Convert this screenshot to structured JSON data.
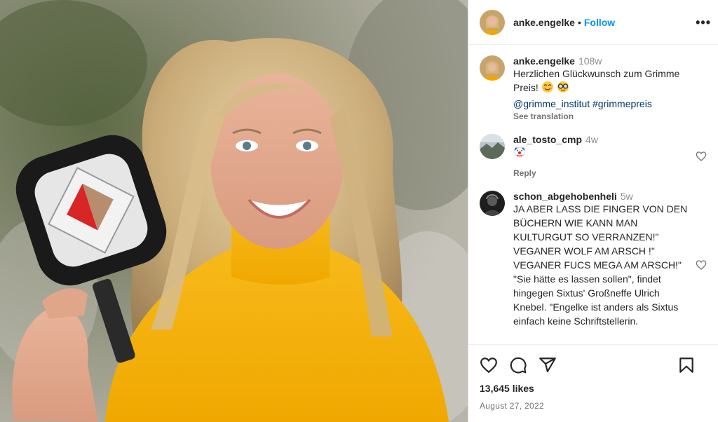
{
  "post": {
    "author": "anke.engelke",
    "follow_label": "Follow",
    "separator": "•",
    "more_label": "•••"
  },
  "caption": {
    "username": "anke.engelke",
    "time": "108w",
    "text": "Herzlichen Glückwunsch zum Grimme Preis!",
    "emojis": [
      "smiling-face-icon",
      "nerd-face-icon"
    ],
    "tags": "@grimme_institut #grimmepreis",
    "see_translation": "See translation"
  },
  "comments": [
    {
      "username": "ale_tosto_cmp",
      "time": "4w",
      "emoji": "clown-face-icon",
      "reply_label": "Reply"
    },
    {
      "username": "schon_abgehobenheli",
      "time": "5w",
      "text": "JA ABER LASS DIE FINGER VON DEN BÜCHERN WIE KANN MAN KULTURGUT SO VERRANZEN!\" VEGANER WOLF AM ARSCH !\" VEGANER FUCS MEGA AM ARSCH!\" \"Sie hätte es lassen sollen\", findet hingegen Sixtus' Großneffe Ulrich Knebel. \"Engelke ist anders als Sixtus einfach keine Schriftstellerin."
    }
  ],
  "stats": {
    "likes": "13,645 likes",
    "date": "August 27, 2022"
  },
  "colors": {
    "link_blue": "#0095f6",
    "tag_blue": "#00376b",
    "muted": "#737373",
    "sweater": "#f5b400"
  }
}
